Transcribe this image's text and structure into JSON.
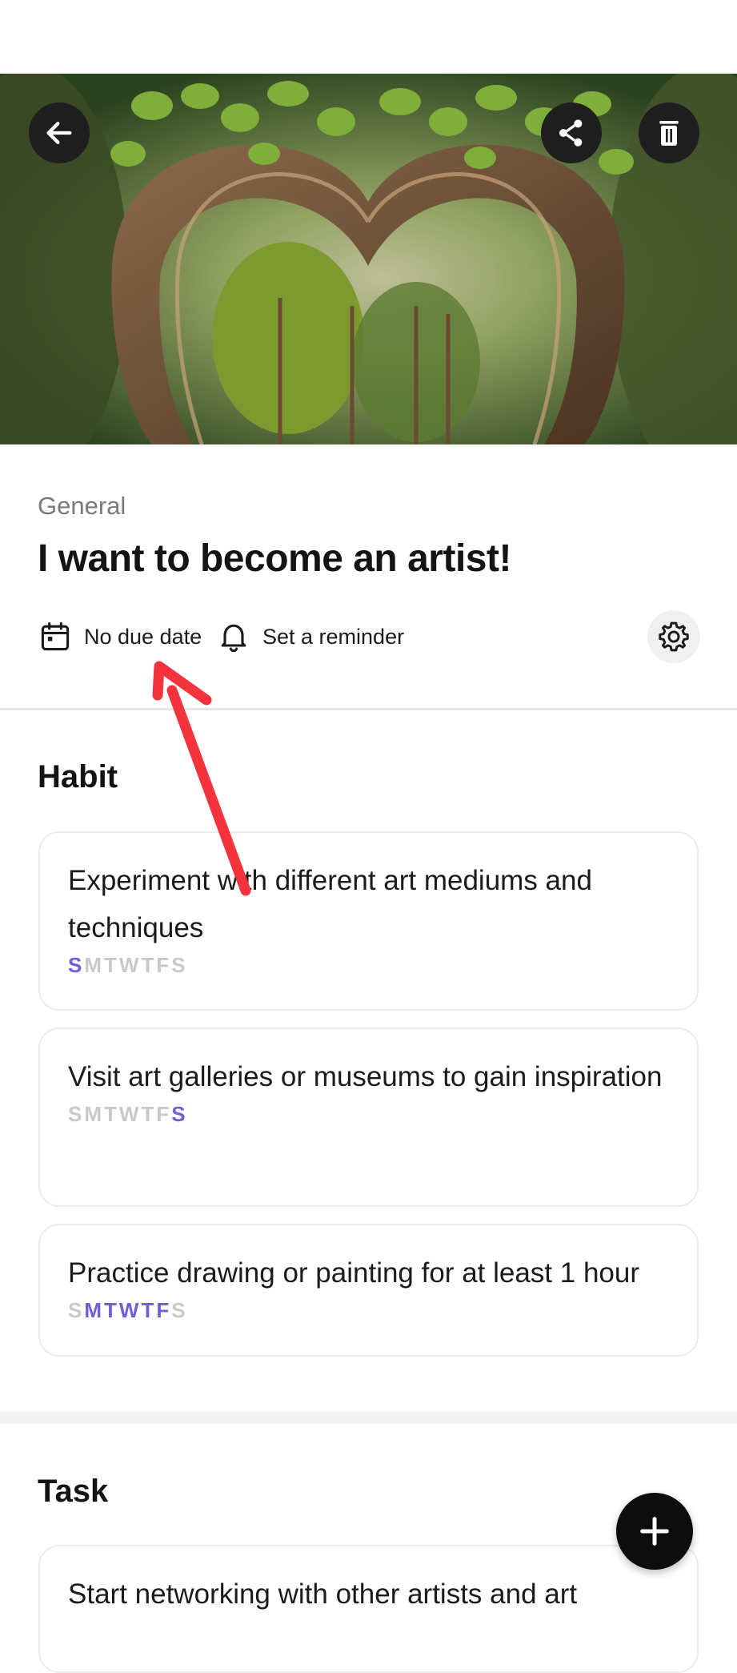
{
  "header": {
    "category": "General",
    "title": "I want to become an artist!",
    "due_date_label": "No due date",
    "reminder_label": "Set a reminder"
  },
  "icons": {
    "back": "arrow-left-icon",
    "share": "share-icon",
    "delete": "trash-icon",
    "calendar": "calendar-icon",
    "bell": "bell-icon",
    "settings": "gear-icon",
    "add": "plus-icon"
  },
  "habit_section": {
    "title": "Habit",
    "items": [
      {
        "text": "Experiment with different art mediums and techniques",
        "days": [
          "S",
          "M",
          "T",
          "W",
          "T",
          "F",
          "S"
        ],
        "active": [
          true,
          false,
          false,
          false,
          false,
          false,
          false
        ]
      },
      {
        "text": "Visit art galleries or museums to gain inspiration",
        "days": [
          "S",
          "M",
          "T",
          "W",
          "T",
          "F",
          "S"
        ],
        "active": [
          false,
          false,
          false,
          false,
          false,
          false,
          true
        ]
      },
      {
        "text": "Practice drawing or painting for at least 1 hour",
        "days": [
          "S",
          "M",
          "T",
          "W",
          "T",
          "F",
          "S"
        ],
        "active": [
          false,
          true,
          true,
          true,
          true,
          true,
          false
        ]
      }
    ]
  },
  "task_section": {
    "title": "Task",
    "items": [
      {
        "text": "Start networking with other artists and art"
      }
    ]
  },
  "colors": {
    "active_day": "#6d5fd6",
    "inactive_day": "#c9c9c9",
    "annotation_arrow": "#f4333d"
  }
}
